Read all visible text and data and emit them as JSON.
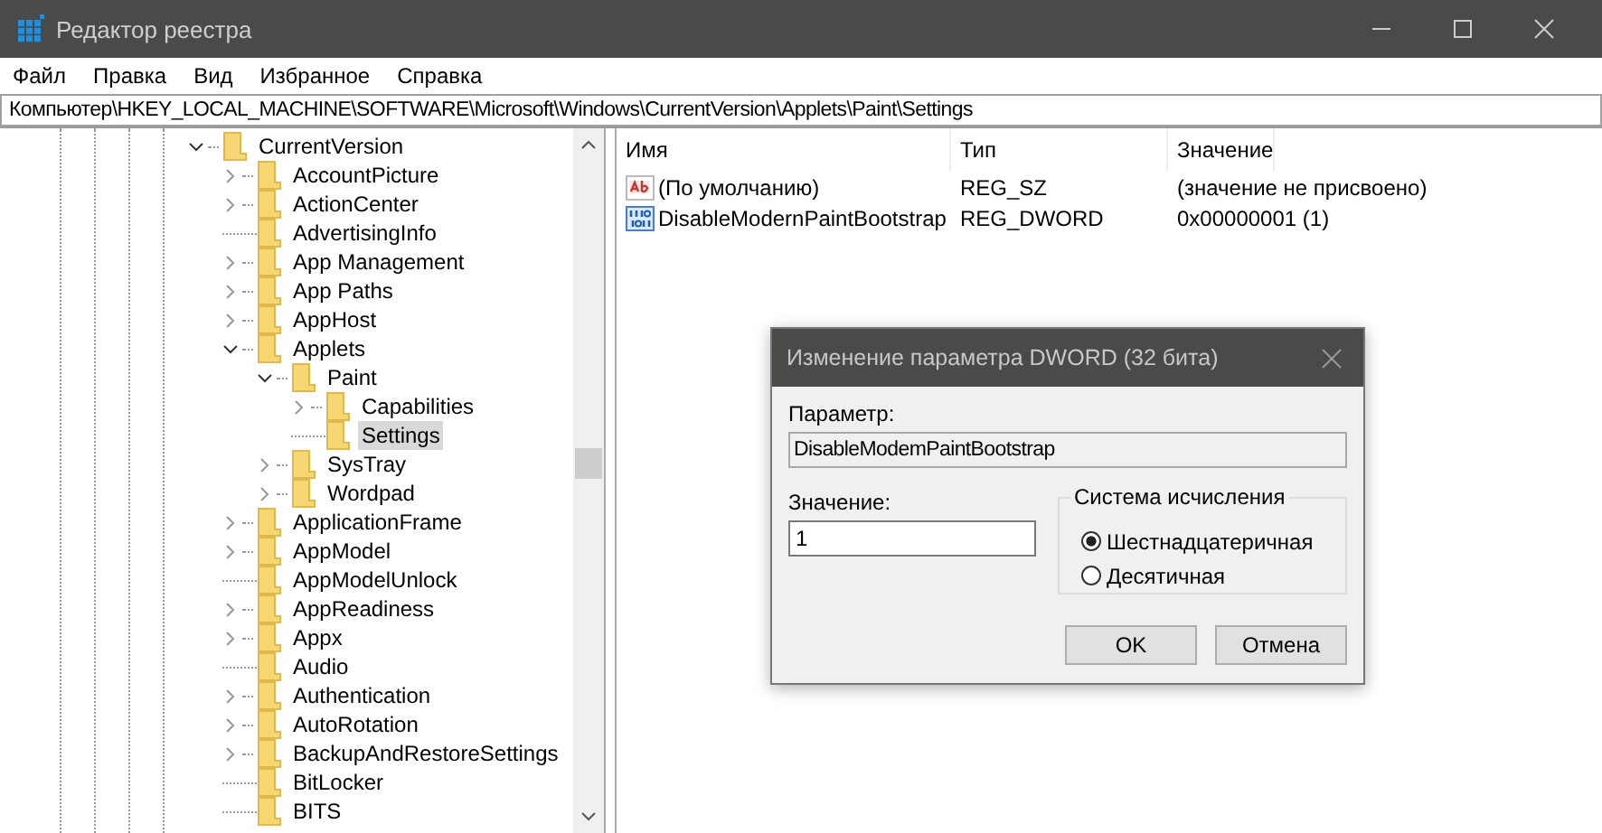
{
  "window": {
    "title": "Редактор реестра"
  },
  "menu": [
    "Файл",
    "Правка",
    "Вид",
    "Избранное",
    "Справка"
  ],
  "address": "Компьютер\\HKEY_LOCAL_MACHINE\\SOFTWARE\\Microsoft\\Windows\\CurrentVersion\\Applets\\Paint\\Settings",
  "tree": [
    {
      "label": "CurrentVersion",
      "expanded": true,
      "selected": false,
      "children": [
        {
          "label": "AccountPicture",
          "expanded": false,
          "selected": false
        },
        {
          "label": "ActionCenter",
          "expanded": false,
          "selected": false
        },
        {
          "label": "AdvertisingInfo",
          "selected": false
        },
        {
          "label": "App Management",
          "expanded": false,
          "selected": false
        },
        {
          "label": "App Paths",
          "expanded": false,
          "selected": false
        },
        {
          "label": "AppHost",
          "expanded": false,
          "selected": false
        },
        {
          "label": "Applets",
          "expanded": true,
          "selected": false,
          "children": [
            {
              "label": "Paint",
              "expanded": true,
              "selected": false,
              "children": [
                {
                  "label": "Capabilities",
                  "expanded": false,
                  "selected": false
                },
                {
                  "label": "Settings",
                  "selected": true
                }
              ]
            },
            {
              "label": "SysTray",
              "expanded": false,
              "selected": false
            },
            {
              "label": "Wordpad",
              "expanded": false,
              "selected": false
            }
          ]
        },
        {
          "label": "ApplicationFrame",
          "expanded": false,
          "selected": false
        },
        {
          "label": "AppModel",
          "expanded": false,
          "selected": false
        },
        {
          "label": "AppModelUnlock",
          "selected": false
        },
        {
          "label": "AppReadiness",
          "expanded": false,
          "selected": false
        },
        {
          "label": "Appx",
          "expanded": false,
          "selected": false
        },
        {
          "label": "Audio",
          "selected": false
        },
        {
          "label": "Authentication",
          "expanded": false,
          "selected": false
        },
        {
          "label": "AutoRotation",
          "expanded": false,
          "selected": false
        },
        {
          "label": "BackupAndRestoreSettings",
          "expanded": false,
          "selected": false
        },
        {
          "label": "BitLocker",
          "selected": false
        },
        {
          "label": "BITS",
          "selected": false
        }
      ]
    }
  ],
  "values": {
    "columns": [
      "Имя",
      "Тип",
      "Значение"
    ],
    "rows": [
      {
        "kind": "string",
        "name": "(По умолчанию)",
        "type": "REG_SZ",
        "data": "(значение не присвоено)"
      },
      {
        "kind": "binary",
        "name": "DisableModernPaintBootstrap",
        "type": "REG_DWORD",
        "data": "0x00000001 (1)"
      }
    ]
  },
  "dialog": {
    "title": "Изменение параметра DWORD (32 бита)",
    "name_label": "Параметр:",
    "name_value": "DisableModemPaintBootstrap",
    "value_label": "Значение:",
    "value": "1",
    "base_group": "Система исчисления",
    "bases": [
      {
        "label": "Шестнадцатеричная",
        "selected": true
      },
      {
        "label": "Десятичная",
        "selected": false
      }
    ],
    "buttons": [
      "OK",
      "Отмена"
    ]
  }
}
